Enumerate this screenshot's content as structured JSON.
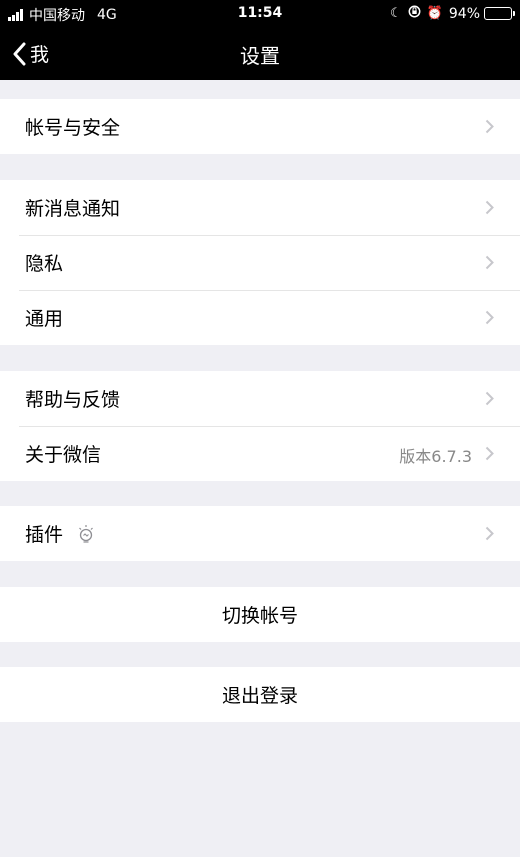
{
  "status_bar": {
    "carrier": "中国移动",
    "network": "4G",
    "time": "11:54",
    "battery_percent": "94%",
    "battery_level": 0.94
  },
  "nav": {
    "back_label": "我",
    "title": "设置"
  },
  "groups": [
    {
      "items": [
        {
          "label": "帐号与安全"
        }
      ]
    },
    {
      "items": [
        {
          "label": "新消息通知"
        },
        {
          "label": "隐私"
        },
        {
          "label": "通用"
        }
      ]
    },
    {
      "items": [
        {
          "label": "帮助与反馈"
        },
        {
          "label": "关于微信",
          "value": "版本6.7.3"
        }
      ]
    },
    {
      "items": [
        {
          "label": "插件",
          "icon": "lightbulb-icon"
        }
      ]
    }
  ],
  "actions": {
    "switch_account": "切换帐号",
    "logout": "退出登录"
  },
  "colors": {
    "background": "#efeff4",
    "nav_bar": "#000000",
    "cell": "#ffffff",
    "chevron": "#c7c7cc",
    "secondary_text": "#888888"
  }
}
